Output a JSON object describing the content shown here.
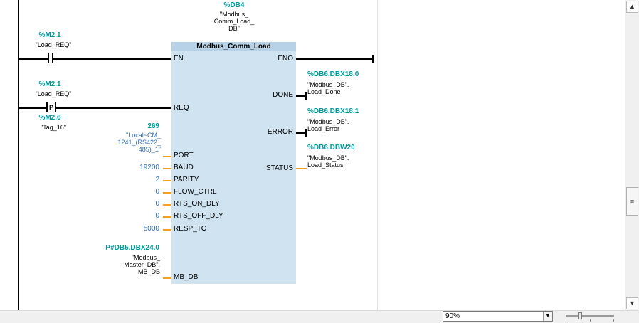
{
  "block": {
    "instance_addr": "%DB4",
    "instance_name": "\"Modbus_\nComm_Load_\nDB\"",
    "title": "Modbus_Comm_Load",
    "pins_in": [
      "EN",
      "REQ",
      "PORT",
      "BAUD",
      "PARITY",
      "FLOW_CTRL",
      "RTS_ON_DLY",
      "RTS_OFF_DLY",
      "RESP_TO",
      "MB_DB"
    ],
    "pins_out": [
      "ENO",
      "DONE",
      "ERROR",
      "STATUS"
    ]
  },
  "contacts": {
    "en_addr": "%M2.1",
    "en_name": "\"Load_REQ\"",
    "req_addr": "%M2.1",
    "req_name": "\"Load_REQ\"",
    "req_symbol": "P",
    "edge_addr": "%M2.6",
    "edge_name": "\"Tag_16\""
  },
  "inputs": {
    "port_value": "269",
    "port_name": "\"Local~CM_\n1241_(RS422_\n485)_1\"",
    "baud": "19200",
    "parity": "2",
    "flow_ctrl": "0",
    "rts_on_dly": "0",
    "rts_off_dly": "0",
    "resp_to": "5000",
    "mb_db_addr": "P#DB5.DBX24.0",
    "mb_db_name": "\"Modbus_\nMaster_DB\".\nMB_DB"
  },
  "outputs": {
    "done_addr": "%DB6.DBX18.0",
    "done_name": "\"Modbus_DB\".\nLoad_Done",
    "error_addr": "%DB6.DBX18.1",
    "error_name": "\"Modbus_DB\".\nLoad_Error",
    "status_addr": "%DB6.DBW20",
    "status_name": "\"Modbus_DB\".\nLoad_Status"
  },
  "statusbar": {
    "zoom": "90%"
  },
  "icons": {
    "scroll_up": "chevron-up-icon",
    "scroll_down": "chevron-down-icon",
    "dropdown": "dropdown-arrow-icon",
    "thumb_grip": "grip-icon"
  },
  "colors": {
    "block_fill": "#cfe3f1",
    "tag_teal": "#009a9a",
    "param_blue": "#2f6db5",
    "param_wire": "#f5a020"
  }
}
